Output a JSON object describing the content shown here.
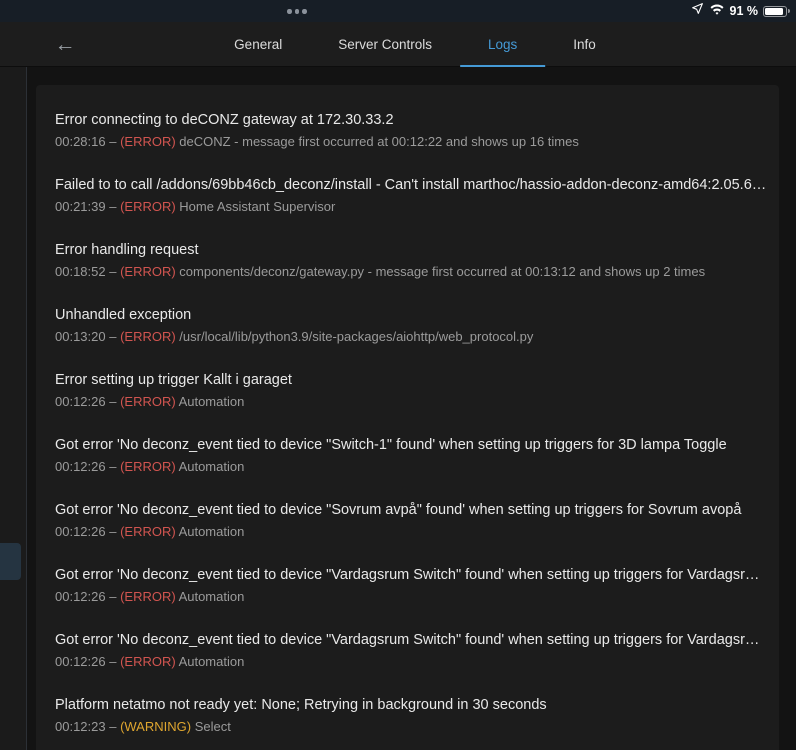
{
  "colors": {
    "accent": "#459ad6",
    "error": "#d25550",
    "warning": "#dfa62f"
  },
  "status_bar": {
    "battery_label": "91 %",
    "battery_level": 91
  },
  "toolbar": {
    "back_icon": "←",
    "tabs": [
      {
        "label": "General",
        "active": false
      },
      {
        "label": "Server Controls",
        "active": false
      },
      {
        "label": "Logs",
        "active": true
      },
      {
        "label": "Info",
        "active": false
      }
    ]
  },
  "logs": {
    "separator": "–",
    "entries": [
      {
        "title": "Error connecting to deCONZ gateway at 172.30.33.2",
        "time": "00:28:16",
        "level": "error",
        "level_label": "(ERROR)",
        "source": "deCONZ - message first occurred at 00:12:22 and shows up 16 times"
      },
      {
        "title": "Failed to to call /addons/69bb46cb_deconz/install - Can't install marthoc/hassio-addon-deconz-amd64:2.05.6…",
        "time": "00:21:39",
        "level": "error",
        "level_label": "(ERROR)",
        "source": "Home Assistant Supervisor"
      },
      {
        "title": "Error handling request",
        "time": "00:18:52",
        "level": "error",
        "level_label": "(ERROR)",
        "source": "components/deconz/gateway.py - message first occurred at 00:13:12 and shows up 2 times"
      },
      {
        "title": "Unhandled exception",
        "time": "00:13:20",
        "level": "error",
        "level_label": "(ERROR)",
        "source": "/usr/local/lib/python3.9/site-packages/aiohttp/web_protocol.py"
      },
      {
        "title": "Error setting up trigger Kallt i garaget",
        "time": "00:12:26",
        "level": "error",
        "level_label": "(ERROR)",
        "source": "Automation"
      },
      {
        "title": "Got error 'No deconz_event tied to device \"Switch-1\" found' when setting up triggers for 3D lampa Toggle",
        "time": "00:12:26",
        "level": "error",
        "level_label": "(ERROR)",
        "source": "Automation"
      },
      {
        "title": "Got error 'No deconz_event tied to device \"Sovrum avpå\" found' when setting up triggers for Sovrum avopå",
        "time": "00:12:26",
        "level": "error",
        "level_label": "(ERROR)",
        "source": "Automation"
      },
      {
        "title": "Got error 'No deconz_event tied to device \"Vardagsrum Switch\" found' when setting up triggers for Vardagsrum…",
        "time": "00:12:26",
        "level": "error",
        "level_label": "(ERROR)",
        "source": "Automation"
      },
      {
        "title": "Got error 'No deconz_event tied to device \"Vardagsrum Switch\" found' when setting up triggers for Vardagsrum…",
        "time": "00:12:26",
        "level": "error",
        "level_label": "(ERROR)",
        "source": "Automation"
      },
      {
        "title": "Platform netatmo not ready yet: None; Retrying in background in 30 seconds",
        "time": "00:12:23",
        "level": "warning",
        "level_label": "(WARNING)",
        "source": "Select"
      }
    ]
  }
}
